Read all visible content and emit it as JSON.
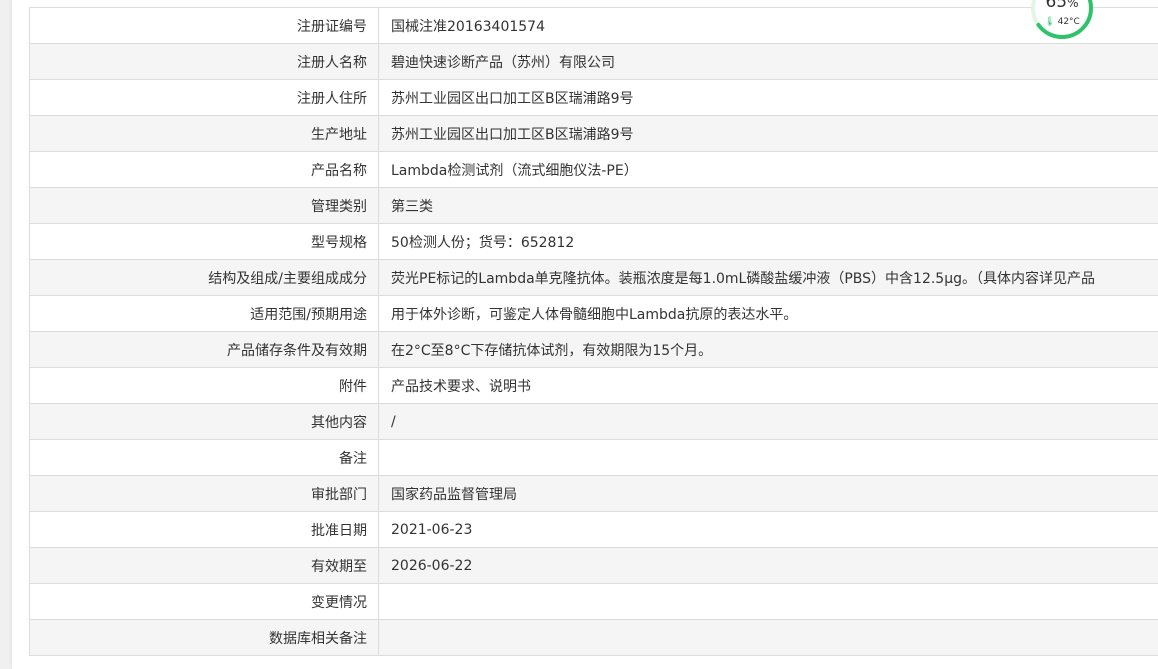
{
  "rows": [
    {
      "label": "注册证编号",
      "value": "国械注准20163401574"
    },
    {
      "label": "注册人名称",
      "value": "碧迪快速诊断产品（苏州）有限公司"
    },
    {
      "label": "注册人住所",
      "value": "苏州工业园区出口加工区B区瑞浦路9号"
    },
    {
      "label": "生产地址",
      "value": "苏州工业园区出口加工区B区瑞浦路9号"
    },
    {
      "label": "产品名称",
      "value": "Lambda检测试剂（流式细胞仪法-PE）"
    },
    {
      "label": "管理类别",
      "value": "第三类"
    },
    {
      "label": "型号规格",
      "value": "50检测人份；货号：652812"
    },
    {
      "label": "结构及组成/主要组成成分",
      "value": "荧光PE标记的Lambda单克隆抗体。装瓶浓度是每1.0mL磷酸盐缓冲液（PBS）中含12.5μg。（具体内容详见产品"
    },
    {
      "label": "适用范围/预期用途",
      "value": "用于体外诊断，可鉴定人体骨髓细胞中Lambda抗原的表达水平。"
    },
    {
      "label": "产品储存条件及有效期",
      "value": "在2°C至8°C下存储抗体试剂，有效期限为15个月。"
    },
    {
      "label": "附件",
      "value": "产品技术要求、说明书"
    },
    {
      "label": "其他内容",
      "value": "/"
    },
    {
      "label": "备注",
      "value": ""
    },
    {
      "label": "审批部门",
      "value": "国家药品监督管理局"
    },
    {
      "label": "批准日期",
      "value": "2021-06-23"
    },
    {
      "label": "有效期至",
      "value": "2026-06-22"
    },
    {
      "label": "变更情况",
      "value": ""
    },
    {
      "label": "数据库相关备注",
      "value": ""
    }
  ],
  "widget": {
    "percent": "65",
    "percent_unit": "%",
    "temperature": "42°C",
    "percent_fraction": 0.65,
    "ring_color": "#2ec36a",
    "thermometer_icon": "thermometer-icon"
  }
}
